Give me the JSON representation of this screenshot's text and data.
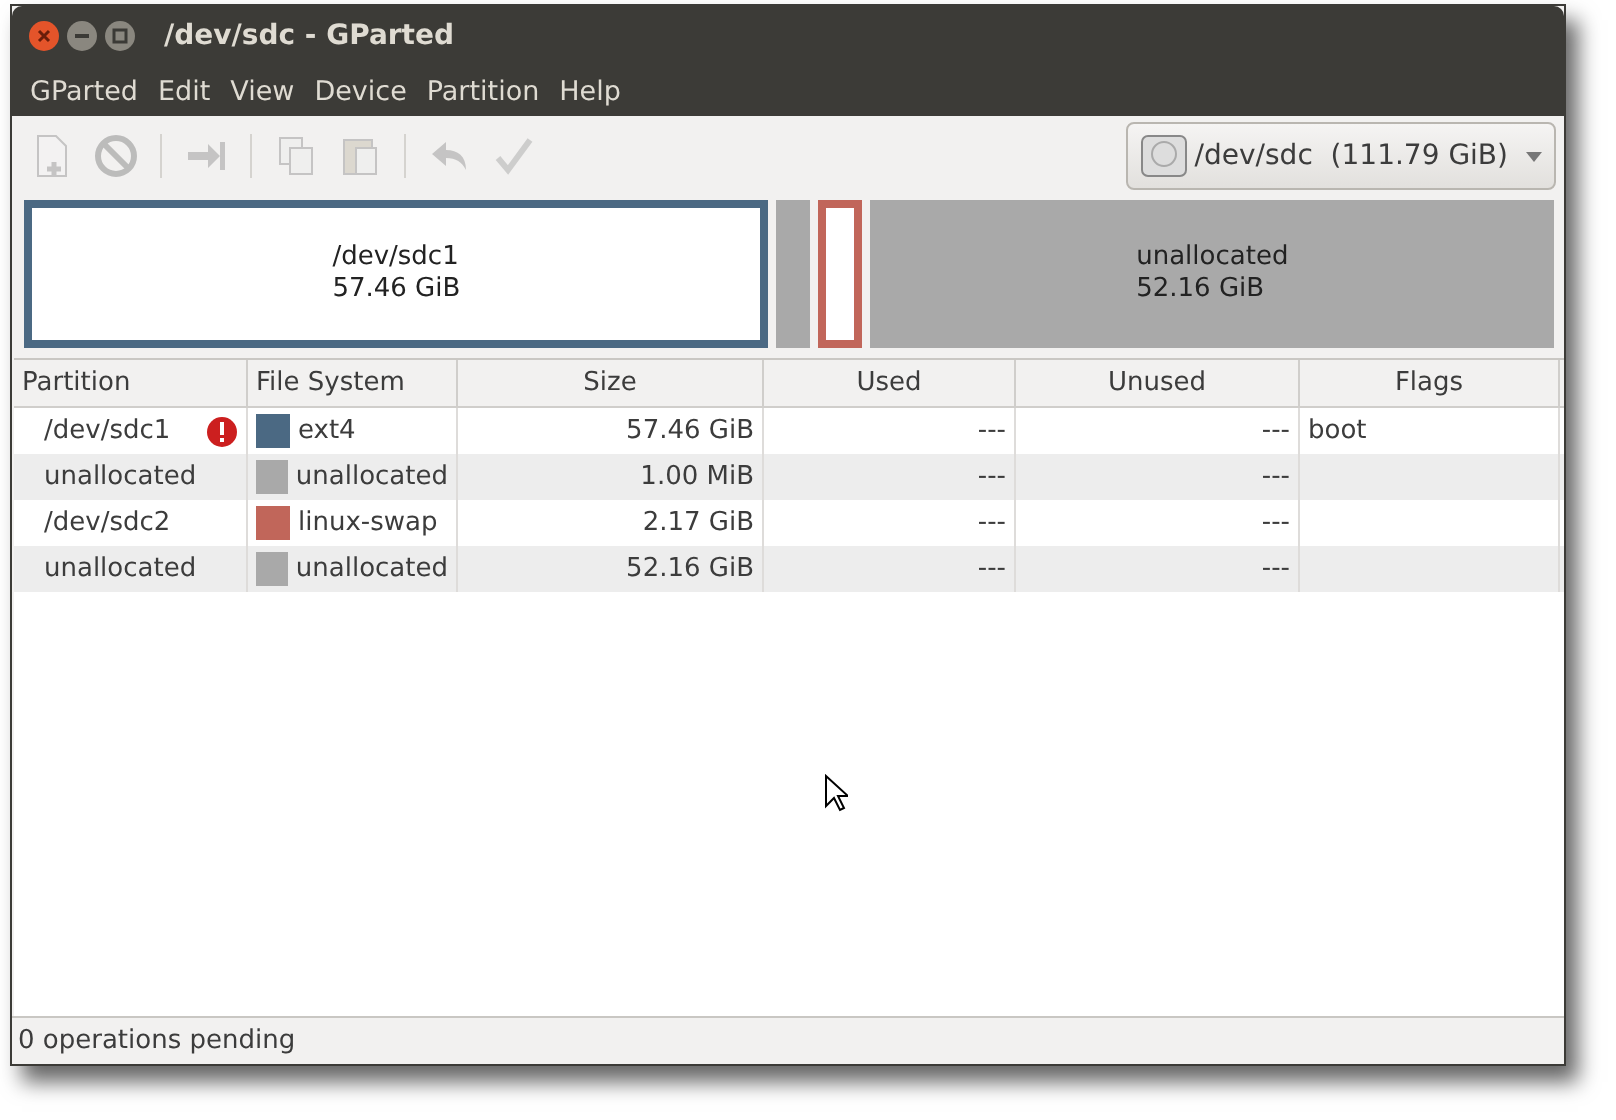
{
  "window": {
    "title": "/dev/sdc - GParted"
  },
  "menu": [
    "GParted",
    "Edit",
    "View",
    "Device",
    "Partition",
    "Help"
  ],
  "toolbar": [
    {
      "kind": "new",
      "disabled": true
    },
    {
      "kind": "delete",
      "disabled": true
    },
    {
      "kind": "sep"
    },
    {
      "kind": "resize",
      "disabled": true
    },
    {
      "kind": "sep"
    },
    {
      "kind": "copy",
      "disabled": true
    },
    {
      "kind": "paste",
      "disabled": true
    },
    {
      "kind": "sep"
    },
    {
      "kind": "undo",
      "disabled": true
    },
    {
      "kind": "apply",
      "disabled": true
    }
  ],
  "device": {
    "label": "/dev/sdc  (111.79 GiB)"
  },
  "map": [
    {
      "kind": "partition",
      "color": "#4b6983",
      "name": "/dev/sdc1",
      "size": "57.46 GiB"
    },
    {
      "kind": "unallocated",
      "color": "#a9a9a9"
    },
    {
      "kind": "partition",
      "color": "#c1665a"
    },
    {
      "kind": "unallocated",
      "color": "#a9a9a9",
      "name": "unallocated",
      "size": "52.16 GiB"
    }
  ],
  "table": {
    "columns": [
      "Partition",
      "File System",
      "Size",
      "Used",
      "Unused",
      "Flags"
    ],
    "rows": [
      {
        "partition": "/dev/sdc1",
        "warning": true,
        "color": "#4b6983",
        "fs": "ext4",
        "size": "57.46 GiB",
        "used": "---",
        "unused": "---",
        "flags": "boot"
      },
      {
        "partition": "unallocated",
        "warning": false,
        "color": "#a9a9a9",
        "fs": "unallocated",
        "size": "1.00 MiB",
        "used": "---",
        "unused": "---"
      },
      {
        "partition": "/dev/sdc2",
        "warning": false,
        "color": "#c1665a",
        "fs": "linux-swap",
        "size": "2.17 GiB",
        "used": "---",
        "unused": "---"
      },
      {
        "partition": "unallocated",
        "warning": false,
        "color": "#a9a9a9",
        "fs": "unallocated",
        "size": "52.16 GiB",
        "used": "---",
        "unused": "---"
      }
    ]
  },
  "status_bar": "0 operations pending"
}
